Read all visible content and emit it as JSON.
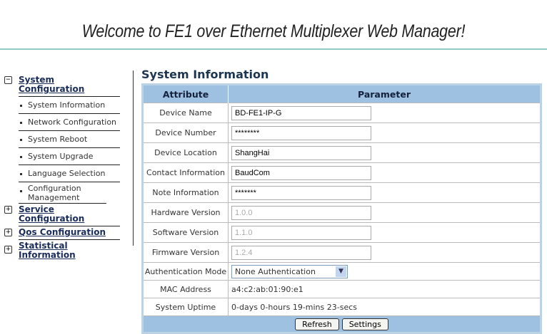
{
  "header": {
    "title": "Welcome to FE1 over Ethernet Multiplexer Web Manager!"
  },
  "sidebar": {
    "groups": [
      {
        "label": "System Configuration",
        "state": "expanded",
        "items": [
          "System Information",
          "Network Configuration",
          "System Reboot",
          "System Upgrade",
          "Language Selection",
          "Configuration Management"
        ]
      },
      {
        "label": "Service Configuration",
        "state": "collapsed"
      },
      {
        "label": "Qos Configuration",
        "state": "collapsed"
      },
      {
        "label": "Statistical Information",
        "state": "collapsed"
      }
    ]
  },
  "main": {
    "title": "System Information",
    "columns": [
      "Attribute",
      "Parameter"
    ],
    "rows": [
      {
        "label": "Device Name",
        "value": "BD-FE1-IP-G"
      },
      {
        "label": "Device Number",
        "value": "********"
      },
      {
        "label": "Device Location",
        "value": "ShangHai"
      },
      {
        "label": "Contact Information",
        "value": "BaudCom"
      },
      {
        "label": "Note Information",
        "value": "*******"
      },
      {
        "label": "Hardware Version",
        "value": "1.0.0"
      },
      {
        "label": "Software Version",
        "value": "1.1.0"
      },
      {
        "label": "Firmware Version",
        "value": "1.2.4"
      },
      {
        "label": "Authentication Mode",
        "value": "None Authentication"
      },
      {
        "label": "MAC Address",
        "value": "a4:c2:ab:01:90:e1"
      },
      {
        "label": "System Uptime",
        "value": "0-days 0-hours 19-mins 23-secs"
      }
    ],
    "buttons": {
      "refresh": "Refresh",
      "settings": "Settings"
    }
  }
}
